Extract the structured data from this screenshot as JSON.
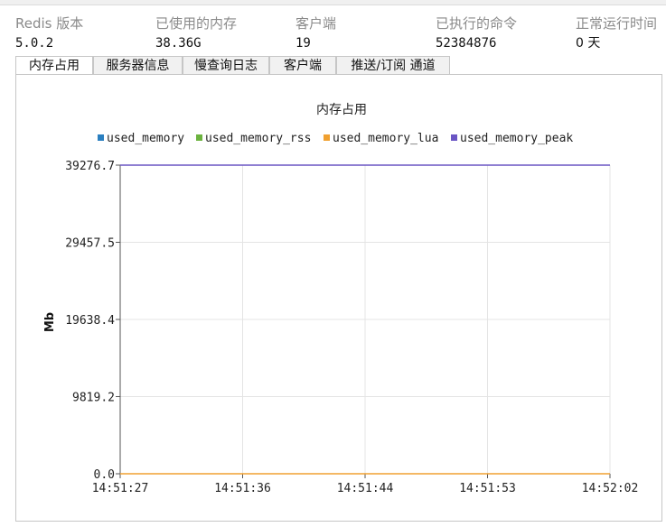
{
  "stats": [
    {
      "label": "Redis 版本",
      "value": "5.0.2"
    },
    {
      "label": "已使用的内存",
      "value": "38.36G"
    },
    {
      "label": "客户端",
      "value": "19"
    },
    {
      "label": "已执行的命令",
      "value": "52384876"
    },
    {
      "label": "正常运行时间",
      "value": "0 天"
    }
  ],
  "tabs": [
    "内存占用",
    "服务器信息",
    "慢查询日志",
    "客户端",
    "推送/订阅 通道"
  ],
  "active_tab": 0,
  "chart_data": {
    "type": "line",
    "title": "内存占用",
    "ylabel": "Mb",
    "xlabel": "",
    "x": [
      "14:51:27",
      "14:51:36",
      "14:51:44",
      "14:51:53",
      "14:52:02"
    ],
    "yticks": [
      "0.0",
      "9819.2",
      "19638.4",
      "29457.5",
      "39276.7"
    ],
    "ylim": [
      0,
      39276.7
    ],
    "grid": true,
    "legend_position": "top",
    "series": [
      {
        "name": "used_memory",
        "color": "#2a7fc0",
        "values": [
          null,
          null,
          null,
          null,
          null
        ]
      },
      {
        "name": "used_memory_rss",
        "color": "#6cb33f",
        "values": [
          null,
          null,
          null,
          null,
          null
        ]
      },
      {
        "name": "used_memory_lua",
        "color": "#f0a030",
        "values": [
          0,
          0,
          0,
          0,
          0
        ]
      },
      {
        "name": "used_memory_peak",
        "color": "#6a55c4",
        "values": [
          39276.7,
          39276.7,
          39276.7,
          39276.7,
          39276.7
        ]
      }
    ]
  }
}
